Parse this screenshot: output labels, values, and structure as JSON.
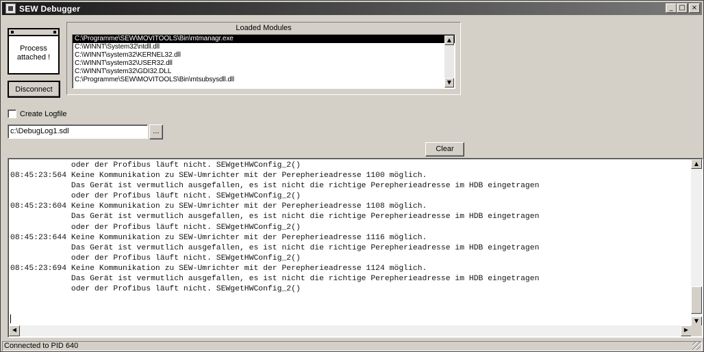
{
  "window": {
    "title": "SEW Debugger",
    "minimize": "_",
    "maximize": "□",
    "close": "×"
  },
  "process": {
    "status": "Process attached !"
  },
  "buttons": {
    "disconnect": "Disconnect",
    "browse": "...",
    "clear": "Clear"
  },
  "modules": {
    "title": "Loaded Modules",
    "items": [
      "C:\\Programme\\SEW\\MOVITOOLS\\Bin\\mtmanagr.exe",
      "C:\\WINNT\\System32\\ntdll.dll",
      "C:\\WINNT\\system32\\KERNEL32.dll",
      "C:\\WINNT\\system32\\USER32.dll",
      "C:\\WINNT\\system32\\GDI32.DLL",
      "C:\\Programme\\SEW\\MOVITOOLS\\Bin\\mtsubsysdll.dll"
    ],
    "selected_index": 0
  },
  "logfile": {
    "checkbox_label": "Create Logfile",
    "checked": false,
    "path": "c:\\DebugLog1.sdl"
  },
  "log": {
    "lines": [
      "             oder der Profibus läuft nicht. SEWgetHWConfig_2()",
      "08:45:23:564 Keine Kommunikation zu SEW-Umrichter mit der Perepherieadresse 1100 möglich.",
      "             Das Gerät ist vermutlich ausgefallen, es ist nicht die richtige Perepherieadresse im HDB eingetragen",
      "             oder der Profibus läuft nicht. SEWgetHWConfig_2()",
      "08:45:23:604 Keine Kommunikation zu SEW-Umrichter mit der Perepherieadresse 1108 möglich.",
      "             Das Gerät ist vermutlich ausgefallen, es ist nicht die richtige Perepherieadresse im HDB eingetragen",
      "             oder der Profibus läuft nicht. SEWgetHWConfig_2()",
      "08:45:23:644 Keine Kommunikation zu SEW-Umrichter mit der Perepherieadresse 1116 möglich.",
      "             Das Gerät ist vermutlich ausgefallen, es ist nicht die richtige Perepherieadresse im HDB eingetragen",
      "             oder der Profibus läuft nicht. SEWgetHWConfig_2()",
      "08:45:23:694 Keine Kommunikation zu SEW-Umrichter mit der Perepherieadresse 1124 möglich.",
      "             Das Gerät ist vermutlich ausgefallen, es ist nicht die richtige Perepherieadresse im HDB eingetragen",
      "             oder der Profibus läuft nicht. SEWgetHWConfig_2()"
    ]
  },
  "statusbar": {
    "text": "Connected to PID 640"
  },
  "icons": {
    "scroll_up": "▲",
    "scroll_down": "▼",
    "scroll_left": "◀",
    "scroll_right": "▶"
  }
}
